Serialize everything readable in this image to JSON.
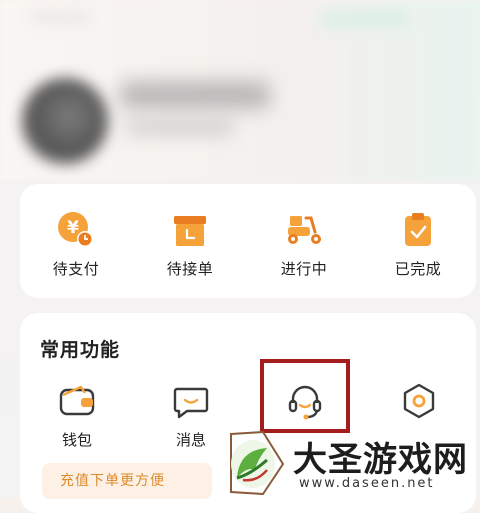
{
  "orders": {
    "items": [
      {
        "label": "待支付",
        "icon": "yuan-clock-icon"
      },
      {
        "label": "待接单",
        "icon": "box-icon"
      },
      {
        "label": "进行中",
        "icon": "scooter-icon"
      },
      {
        "label": "已完成",
        "icon": "clipboard-check-icon"
      }
    ]
  },
  "functions": {
    "title": "常用功能",
    "items": [
      {
        "label": "钱包",
        "icon": "wallet-icon"
      },
      {
        "label": "消息",
        "icon": "message-icon"
      },
      {
        "label": "",
        "icon": "headset-icon"
      },
      {
        "label": "",
        "icon": "settings-icon"
      }
    ],
    "promo": "充值下单更方便"
  },
  "watermark": {
    "title": "大圣游戏网",
    "url": "www.daseen.net"
  },
  "colors": {
    "accent": "#f5a23a",
    "highlight": "#a41d1d"
  }
}
